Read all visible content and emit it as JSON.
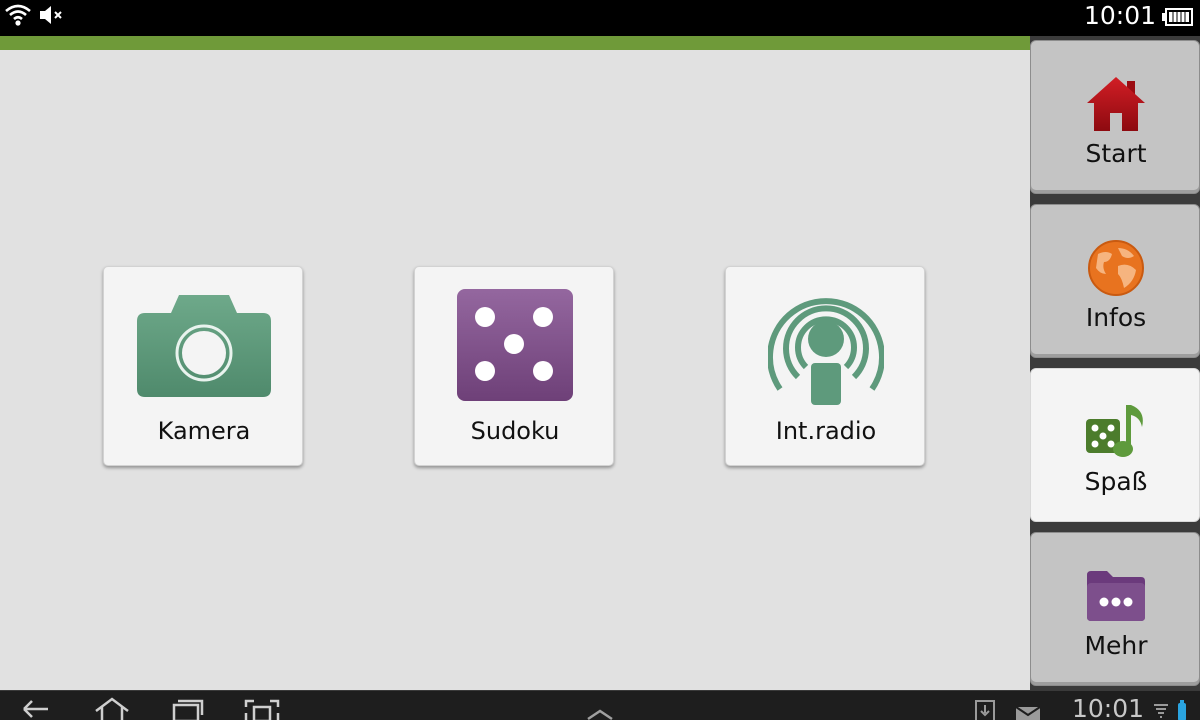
{
  "status_bar": {
    "time": "10:01",
    "icons": [
      "wifi-icon",
      "muted-speaker-icon",
      "battery-icon"
    ]
  },
  "apps": [
    {
      "label": "Kamera",
      "icon": "camera-icon"
    },
    {
      "label": "Sudoku",
      "icon": "dice-icon"
    },
    {
      "label": "Int.radio",
      "icon": "radio-broadcast-icon"
    }
  ],
  "tabs": [
    {
      "label": "Start",
      "icon": "house-icon",
      "active": false
    },
    {
      "label": "Infos",
      "icon": "globe-icon",
      "active": false
    },
    {
      "label": "Spaß",
      "icon": "dice-music-icon",
      "active": true
    },
    {
      "label": "Mehr",
      "icon": "folder-more-icon",
      "active": false
    }
  ],
  "nav_bar": {
    "time": "10:01",
    "buttons": [
      "back-icon",
      "home-icon",
      "recent-apps-icon",
      "screenshot-icon",
      "expand-up-icon"
    ]
  },
  "colors": {
    "accent_green": "#6f9a39",
    "app_green": "#5e9a7c",
    "app_purple": "#7d4f8c",
    "home_red": "#b3111a",
    "globe_orange": "#e8731f"
  }
}
